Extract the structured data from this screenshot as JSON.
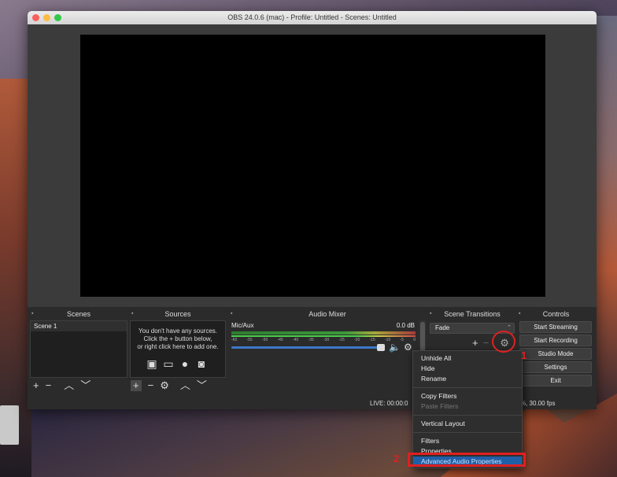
{
  "window": {
    "title": "OBS 24.0.6 (mac) - Profile: Untitled - Scenes: Untitled"
  },
  "panels": {
    "scenes": {
      "title": "Scenes",
      "items": [
        "Scene 1"
      ]
    },
    "sources": {
      "title": "Sources",
      "empty_line1": "You don't have any sources.",
      "empty_line2": "Click the + button below,",
      "empty_line3": "or right click here to add one."
    },
    "audio_mixer": {
      "title": "Audio Mixer",
      "channel": "Mic/Aux",
      "level": "0.0 dB",
      "ticks": [
        "-60",
        "-55",
        "-50",
        "-45",
        "-40",
        "-35",
        "-30",
        "-25",
        "-20",
        "-15",
        "-10",
        "-5",
        "0"
      ]
    },
    "scene_transitions": {
      "title": "Scene Transitions",
      "selected": "Fade"
    },
    "controls": {
      "title": "Controls",
      "buttons": [
        "Start Streaming",
        "Start Recording",
        "Studio Mode",
        "Settings",
        "Exit"
      ]
    }
  },
  "status_bar": {
    "live": "LIVE: 00:00:0",
    "fps": "%, 30.00 fps"
  },
  "context_menu": {
    "items": [
      {
        "label": "Unhide All",
        "disabled": false
      },
      {
        "label": "Hide",
        "disabled": false
      },
      {
        "label": "Rename",
        "disabled": false
      },
      {
        "label": "Copy Filters",
        "disabled": false
      },
      {
        "label": "Paste Filters",
        "disabled": true
      },
      {
        "label": "Vertical Layout",
        "disabled": false
      },
      {
        "label": "Filters",
        "disabled": false
      },
      {
        "label": "Properties",
        "disabled": false
      },
      {
        "label": "Advanced Audio Properties",
        "disabled": false
      }
    ]
  },
  "annotations": {
    "step1": "1",
    "step2": "2",
    "color": "#e02020"
  },
  "icons": [
    "plus-icon",
    "minus-icon",
    "arrow-up-icon",
    "arrow-down-icon",
    "gear-icon",
    "speaker-icon",
    "image-icon",
    "display-icon",
    "globe-icon",
    "camera-icon"
  ]
}
